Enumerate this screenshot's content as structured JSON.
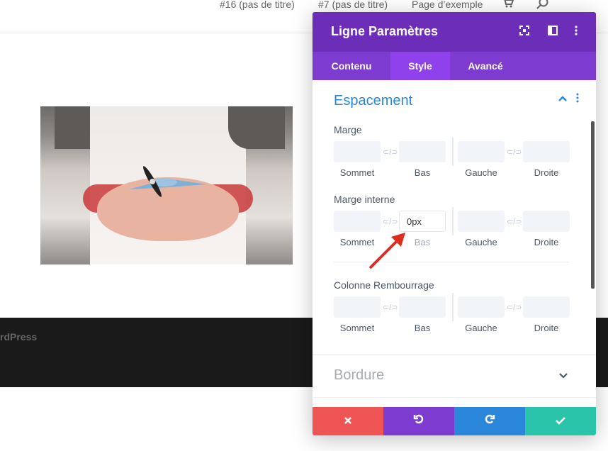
{
  "nav": {
    "links": [
      "#16 (pas de titre)",
      "#7 (pas de titre)",
      "Page d’exemple"
    ],
    "cart_icon": "cart-icon",
    "search_icon": "search-icon"
  },
  "footer": {
    "text": "rdPress"
  },
  "panel": {
    "title": "Ligne Paramètres",
    "header_icons": [
      "fullscreen-icon",
      "sidebar-icon",
      "more-icon"
    ],
    "tabs": [
      {
        "label": "Contenu",
        "active": false
      },
      {
        "label": "Style",
        "active": true
      },
      {
        "label": "Avancé",
        "active": false
      }
    ],
    "section_title": "Espacement",
    "fields": [
      {
        "label": "Marge",
        "values": [
          "",
          "",
          "",
          ""
        ],
        "sublabels": [
          "Sommet",
          "Bas",
          "Gauche",
          "Droite"
        ]
      },
      {
        "label": "Marge interne",
        "values": [
          "",
          "0px",
          "",
          ""
        ],
        "sublabels": [
          "Sommet",
          "Bas",
          "Gauche",
          "Droite"
        ]
      },
      {
        "label": "Colonne Rembourrage",
        "values": [
          "",
          "",
          "",
          ""
        ],
        "sublabels": [
          "Sommet",
          "Bas",
          "Gauche",
          "Droite"
        ]
      }
    ],
    "section2_title": "Bordure",
    "footer_buttons": [
      {
        "name": "cancel",
        "icon": "close-icon",
        "color": "#ef5555"
      },
      {
        "name": "undo",
        "icon": "undo-icon",
        "color": "#7e3bd0"
      },
      {
        "name": "redo",
        "icon": "redo-icon",
        "color": "#2b87da"
      },
      {
        "name": "save",
        "icon": "check-icon",
        "color": "#29c4a9"
      }
    ]
  },
  "colors": {
    "header": "#6c2eb9",
    "tabs": "#7d3bcf",
    "active_tab": "#8f42ec",
    "accent": "#2b87da",
    "annotation_arrow": "#e02b20"
  }
}
